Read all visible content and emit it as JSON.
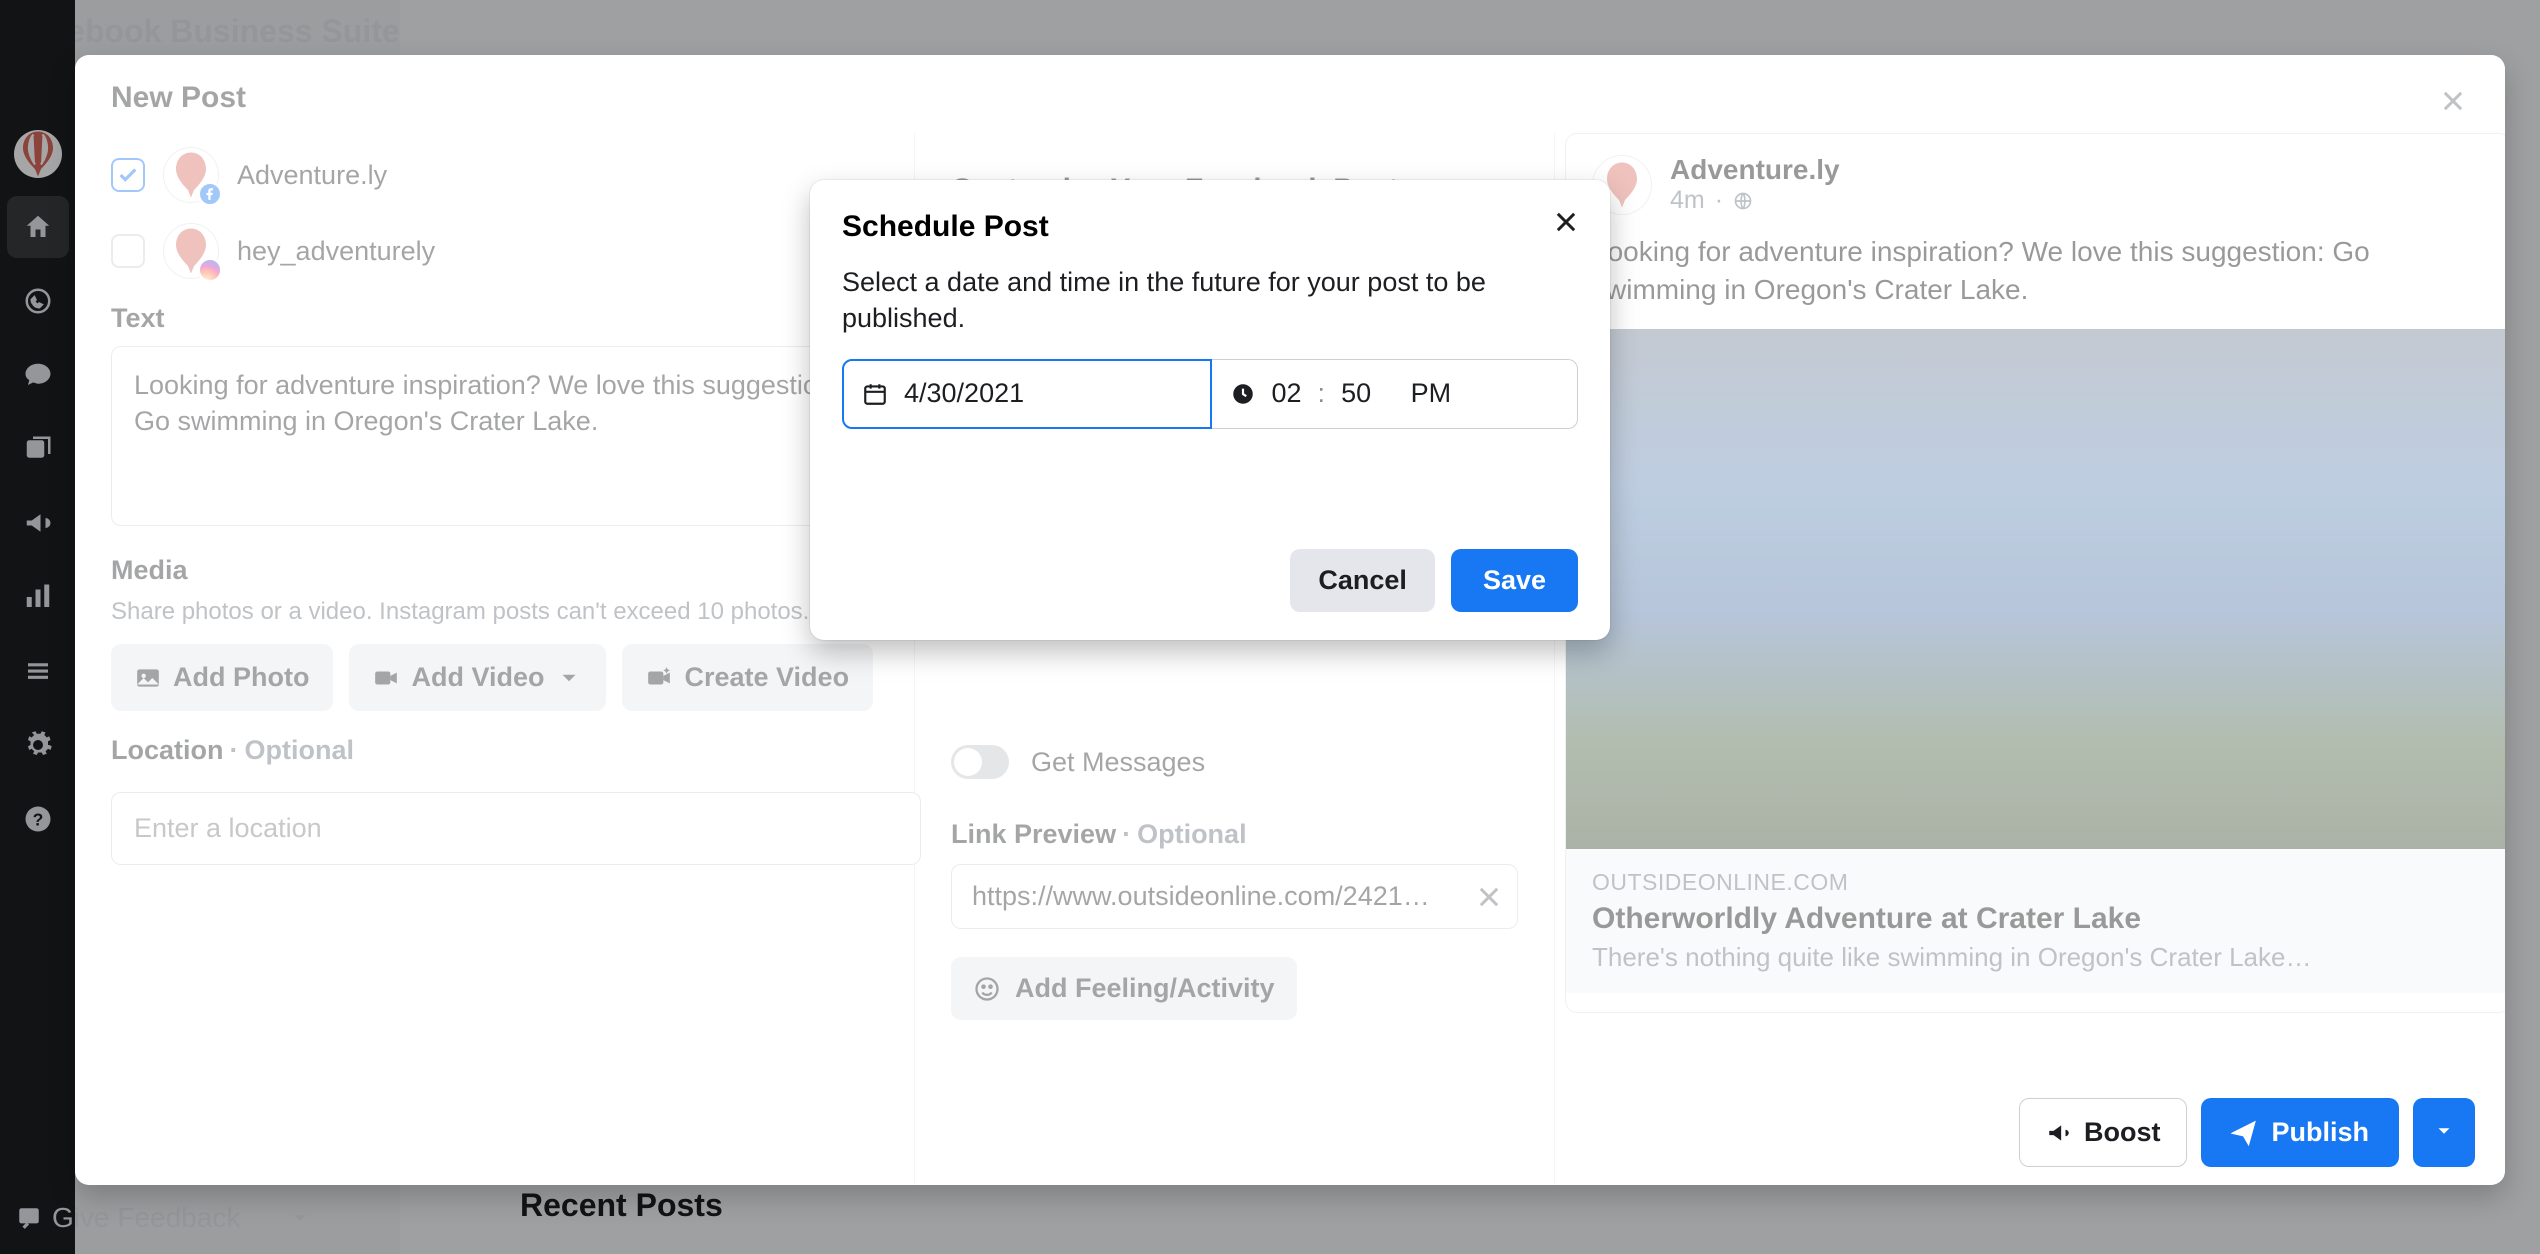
{
  "brand": "Facebook Business Suite",
  "leftnav": {
    "feedback": "Give Feedback"
  },
  "recent_posts_heading": "Recent Posts",
  "new_post": {
    "title": "New Post",
    "pages": [
      {
        "name": "Adventure.ly",
        "checked": true,
        "platform": "facebook"
      },
      {
        "name": "hey_adventurely",
        "checked": false,
        "platform": "instagram"
      }
    ],
    "text_label": "Text",
    "text_value": "Looking for adventure inspiration? We love this suggestion: Go swimming in Oregon's Crater Lake.",
    "media_label": "Media",
    "media_sub": "Share photos or a video. Instagram posts can't exceed 10 photos.",
    "add_photo": "Add Photo",
    "add_video": "Add Video",
    "create_video": "Create Video",
    "location_label": "Location",
    "location_optional": "Optional",
    "location_placeholder": "Enter a location"
  },
  "mid": {
    "customize_heading": "Customize Your Facebook Post",
    "get_messages": "Get Messages",
    "link_preview_label": "Link Preview",
    "link_preview_optional": "Optional",
    "link_url": "https://www.outsideonline.com/2421…",
    "add_feeling": "Add Feeling/Activity"
  },
  "preview": {
    "page_name": "Adventure.ly",
    "time": "4m",
    "text": "Looking for adventure inspiration? We love this suggestion: Go swimming in Oregon's Crater Lake.",
    "domain": "OUTSIDEONLINE.COM",
    "title": "Otherworldly Adventure at Crater Lake",
    "desc": "There's nothing quite like swimming in Oregon's Crater Lake…"
  },
  "footer": {
    "boost": "Boost",
    "publish": "Publish"
  },
  "schedule": {
    "title": "Schedule Post",
    "desc": "Select a date and time in the future for your post to be published.",
    "date": "4/30/2021",
    "time_h": "02",
    "time_m": "50",
    "time_ampm": "PM",
    "cancel": "Cancel",
    "save": "Save"
  }
}
